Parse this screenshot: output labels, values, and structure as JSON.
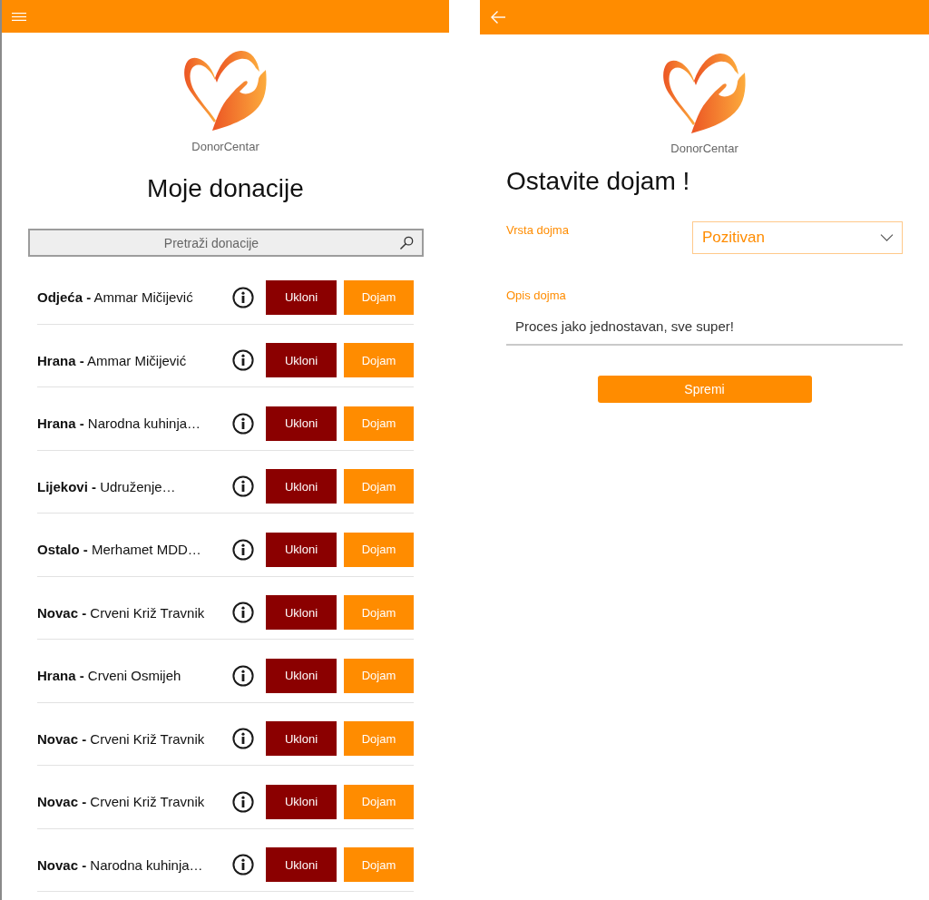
{
  "left_screen": {
    "brand": "DonorCentar",
    "title": "Moje donacije",
    "search": {
      "placeholder": "Pretraži donacije"
    },
    "donations": [
      {
        "label": "**Odjeća -** Ammar Mičijević",
        "remove_button": "Ukloni",
        "feedback_button": "Dojam"
      },
      {
        "label": "**Hrana -** Ammar Mičijević",
        "remove_button": "Ukloni",
        "feedback_button": "Dojam"
      },
      {
        "label": "**Hrana -** Narodna kuhinja…",
        "remove_button": "Ukloni",
        "feedback_button": "Dojam"
      },
      {
        "label": "**Lijekovi -** Udruženje…",
        "remove_button": "Ukloni",
        "feedback_button": "Dojam"
      },
      {
        "label": "**Ostalo -** Merhamet MDD…",
        "remove_button": "Ukloni",
        "feedback_button": "Dojam"
      },
      {
        "label": "**Novac -** Crveni Križ Travnik",
        "remove_button": "Ukloni",
        "feedback_button": "Dojam"
      },
      {
        "label": "**Hrana -** Crveni Osmijeh",
        "remove_button": "Ukloni",
        "feedback_button": "Dojam"
      },
      {
        "label": "**Novac -** Crveni Križ Travnik",
        "remove_button": "Ukloni",
        "feedback_button": "Dojam"
      },
      {
        "label": "**Novac -** Crveni Križ Travnik",
        "remove_button": "Ukloni",
        "feedback_button": "Dojam"
      },
      {
        "label": "**Novac -** Narodna kuhinja…",
        "remove_button": "Ukloni",
        "feedback_button": "Dojam"
      }
    ]
  },
  "right_screen": {
    "brand": "DonorCentar",
    "title": "Ostavite dojam !",
    "impression_type": {
      "label": "Vrsta dojma",
      "value": "Pozitivan"
    },
    "impression_description": {
      "label": "Opis dojma",
      "value": "Proces jako jednostavan, sve super!"
    },
    "save_button": "Spremi"
  }
}
